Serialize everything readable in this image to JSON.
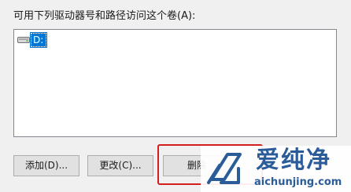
{
  "dialog": {
    "caption": "可用下列驱动器号和路径访问这个卷(A):",
    "list": {
      "items": [
        {
          "icon": "drive-icon",
          "label": "D:"
        }
      ]
    },
    "buttons": {
      "add_label": "添加(D)...",
      "change_label": "更改(C)...",
      "remove_label": "删除"
    }
  },
  "watermark": {
    "title": "爱纯净",
    "url": "aichunjing.com",
    "icon": "logo-icon"
  },
  "colors": {
    "selection": "#0078d7",
    "highlight_border": "#d21e1e",
    "watermark_text": "#2a5c9a"
  }
}
